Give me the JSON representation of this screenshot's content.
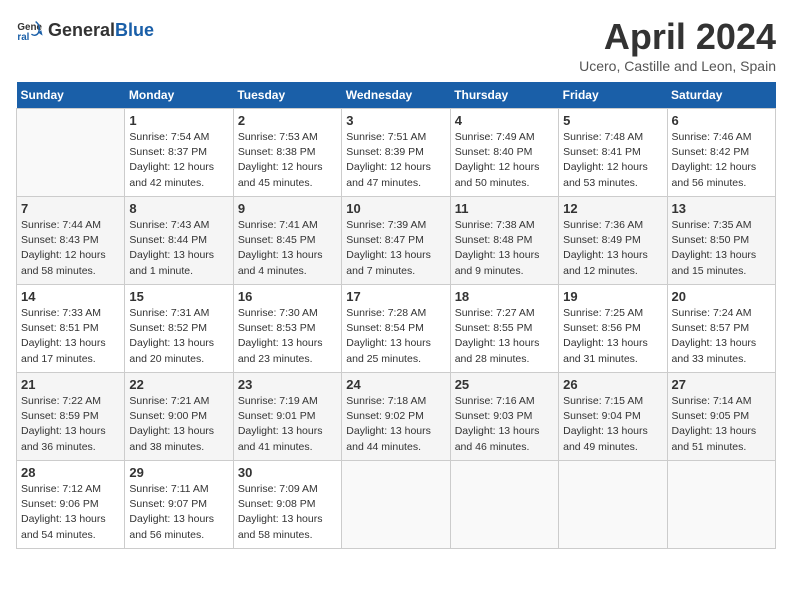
{
  "header": {
    "logo_general": "General",
    "logo_blue": "Blue",
    "title": "April 2024",
    "location": "Ucero, Castille and Leon, Spain"
  },
  "columns": [
    "Sunday",
    "Monday",
    "Tuesday",
    "Wednesday",
    "Thursday",
    "Friday",
    "Saturday"
  ],
  "weeks": [
    [
      {
        "day": "",
        "info": ""
      },
      {
        "day": "1",
        "info": "Sunrise: 7:54 AM\nSunset: 8:37 PM\nDaylight: 12 hours\nand 42 minutes."
      },
      {
        "day": "2",
        "info": "Sunrise: 7:53 AM\nSunset: 8:38 PM\nDaylight: 12 hours\nand 45 minutes."
      },
      {
        "day": "3",
        "info": "Sunrise: 7:51 AM\nSunset: 8:39 PM\nDaylight: 12 hours\nand 47 minutes."
      },
      {
        "day": "4",
        "info": "Sunrise: 7:49 AM\nSunset: 8:40 PM\nDaylight: 12 hours\nand 50 minutes."
      },
      {
        "day": "5",
        "info": "Sunrise: 7:48 AM\nSunset: 8:41 PM\nDaylight: 12 hours\nand 53 minutes."
      },
      {
        "day": "6",
        "info": "Sunrise: 7:46 AM\nSunset: 8:42 PM\nDaylight: 12 hours\nand 56 minutes."
      }
    ],
    [
      {
        "day": "7",
        "info": "Sunrise: 7:44 AM\nSunset: 8:43 PM\nDaylight: 12 hours\nand 58 minutes."
      },
      {
        "day": "8",
        "info": "Sunrise: 7:43 AM\nSunset: 8:44 PM\nDaylight: 13 hours\nand 1 minute."
      },
      {
        "day": "9",
        "info": "Sunrise: 7:41 AM\nSunset: 8:45 PM\nDaylight: 13 hours\nand 4 minutes."
      },
      {
        "day": "10",
        "info": "Sunrise: 7:39 AM\nSunset: 8:47 PM\nDaylight: 13 hours\nand 7 minutes."
      },
      {
        "day": "11",
        "info": "Sunrise: 7:38 AM\nSunset: 8:48 PM\nDaylight: 13 hours\nand 9 minutes."
      },
      {
        "day": "12",
        "info": "Sunrise: 7:36 AM\nSunset: 8:49 PM\nDaylight: 13 hours\nand 12 minutes."
      },
      {
        "day": "13",
        "info": "Sunrise: 7:35 AM\nSunset: 8:50 PM\nDaylight: 13 hours\nand 15 minutes."
      }
    ],
    [
      {
        "day": "14",
        "info": "Sunrise: 7:33 AM\nSunset: 8:51 PM\nDaylight: 13 hours\nand 17 minutes."
      },
      {
        "day": "15",
        "info": "Sunrise: 7:31 AM\nSunset: 8:52 PM\nDaylight: 13 hours\nand 20 minutes."
      },
      {
        "day": "16",
        "info": "Sunrise: 7:30 AM\nSunset: 8:53 PM\nDaylight: 13 hours\nand 23 minutes."
      },
      {
        "day": "17",
        "info": "Sunrise: 7:28 AM\nSunset: 8:54 PM\nDaylight: 13 hours\nand 25 minutes."
      },
      {
        "day": "18",
        "info": "Sunrise: 7:27 AM\nSunset: 8:55 PM\nDaylight: 13 hours\nand 28 minutes."
      },
      {
        "day": "19",
        "info": "Sunrise: 7:25 AM\nSunset: 8:56 PM\nDaylight: 13 hours\nand 31 minutes."
      },
      {
        "day": "20",
        "info": "Sunrise: 7:24 AM\nSunset: 8:57 PM\nDaylight: 13 hours\nand 33 minutes."
      }
    ],
    [
      {
        "day": "21",
        "info": "Sunrise: 7:22 AM\nSunset: 8:59 PM\nDaylight: 13 hours\nand 36 minutes."
      },
      {
        "day": "22",
        "info": "Sunrise: 7:21 AM\nSunset: 9:00 PM\nDaylight: 13 hours\nand 38 minutes."
      },
      {
        "day": "23",
        "info": "Sunrise: 7:19 AM\nSunset: 9:01 PM\nDaylight: 13 hours\nand 41 minutes."
      },
      {
        "day": "24",
        "info": "Sunrise: 7:18 AM\nSunset: 9:02 PM\nDaylight: 13 hours\nand 44 minutes."
      },
      {
        "day": "25",
        "info": "Sunrise: 7:16 AM\nSunset: 9:03 PM\nDaylight: 13 hours\nand 46 minutes."
      },
      {
        "day": "26",
        "info": "Sunrise: 7:15 AM\nSunset: 9:04 PM\nDaylight: 13 hours\nand 49 minutes."
      },
      {
        "day": "27",
        "info": "Sunrise: 7:14 AM\nSunset: 9:05 PM\nDaylight: 13 hours\nand 51 minutes."
      }
    ],
    [
      {
        "day": "28",
        "info": "Sunrise: 7:12 AM\nSunset: 9:06 PM\nDaylight: 13 hours\nand 54 minutes."
      },
      {
        "day": "29",
        "info": "Sunrise: 7:11 AM\nSunset: 9:07 PM\nDaylight: 13 hours\nand 56 minutes."
      },
      {
        "day": "30",
        "info": "Sunrise: 7:09 AM\nSunset: 9:08 PM\nDaylight: 13 hours\nand 58 minutes."
      },
      {
        "day": "",
        "info": ""
      },
      {
        "day": "",
        "info": ""
      },
      {
        "day": "",
        "info": ""
      },
      {
        "day": "",
        "info": ""
      }
    ]
  ]
}
